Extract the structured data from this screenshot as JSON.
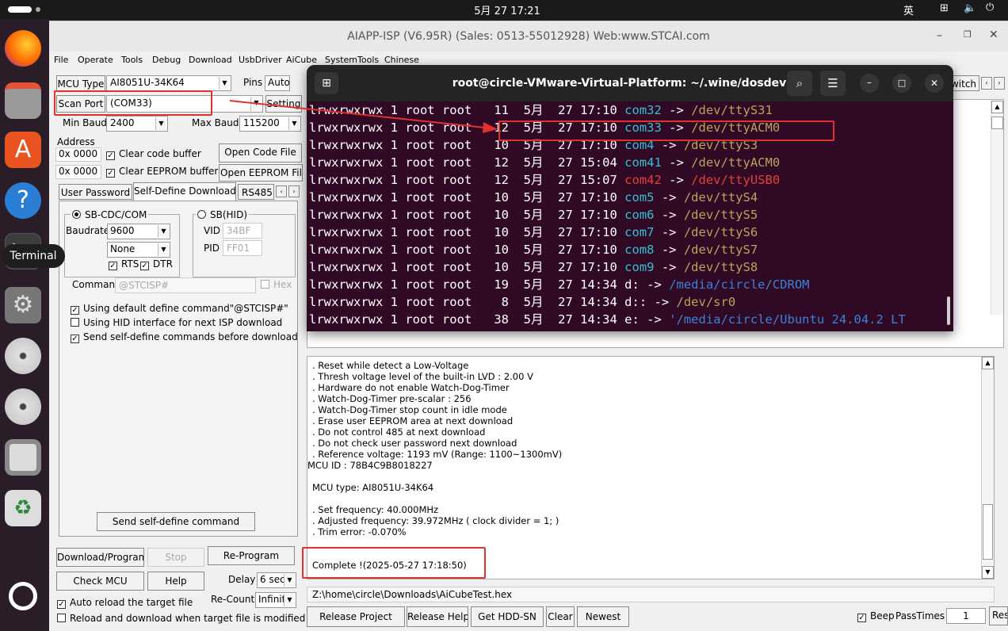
{
  "system": {
    "clock": "5月 27  17:21",
    "ime": "英"
  },
  "dock": {
    "tooltip": "Terminal"
  },
  "window": {
    "title": "AIAPP-ISP (V6.95R) (Sales: 0513-55012928) Web:www.STCAI.com"
  },
  "menu": [
    "File",
    "Operate",
    "Tools",
    "Debug",
    "Download",
    "UsbDriver",
    "AiCube",
    "SystemTools",
    "Chinese"
  ],
  "left": {
    "mcu_type_label": "MCU Type",
    "mcu_type": "AI8051U-34K64",
    "pins_label": "Pins",
    "pins": "Auto",
    "scan_port": "Scan Port",
    "port": "(COM33)",
    "setting": "Setting",
    "min_baud_label": "Min Baud",
    "min_baud": "2400",
    "max_baud_label": "Max Baud",
    "max_baud": "115200",
    "address_label": "Address",
    "addr1": "0x 0000",
    "addr2": "0x 0000",
    "clear_code": "Clear code buffer",
    "clear_eeprom": "Clear EEPROM buffer",
    "open_code": "Open Code File",
    "open_eeprom": "Open EEPROM File",
    "tabs": [
      "User Password",
      "Self-Define Download",
      "RS485"
    ],
    "sb_cdc": "SB-CDC/COM",
    "sb_hid": "SB(HID)",
    "baudrate_label": "Baudrate",
    "baudrate": "9600",
    "parity": "None",
    "vid_label": "VID",
    "vid": "34BF",
    "pid_label": "PID",
    "pid": "FF01",
    "rts": "RTS",
    "dtr": "DTR",
    "command_label": "Command",
    "command": "@STCISP#",
    "hex": "Hex",
    "opt1": "Using default define command\"@STCISP#\"",
    "opt2": "Using HID interface for next ISP download",
    "opt3": "Send self-define commands before download",
    "send_cmd": "Send self-define command",
    "download": "Download/Program",
    "stop": "Stop",
    "reprogram": "Re-Program",
    "check_mcu": "Check MCU",
    "help": "Help",
    "delay_label": "Delay",
    "delay": "6 sec",
    "recount_label": "Re-Count",
    "recount": "Infinite",
    "auto_reload": "Auto reload the target file",
    "reload_modified": "Reload and download when target file is modified"
  },
  "right": {
    "switch": "witch"
  },
  "log": {
    "lines": [
      ". Reset while detect a Low-Voltage",
      ". Thresh voltage level of the built-in LVD : 2.00 V",
      ". Hardware do not enable Watch-Dog-Timer",
      ". Watch-Dog-Timer pre-scalar : 256",
      ". Watch-Dog-Timer stop count in idle mode",
      ". Erase user EEPROM area at next download",
      ". Do not control 485 at next download",
      ". Do not check user password next download",
      ". Reference voltage: 1193 mV (Range: 1100~1300mV)",
      "MCU ID : 78B4C9B8018227",
      "",
      "MCU type: AI8051U-34K64",
      "",
      ". Set frequency: 40.000MHz",
      ". Adjusted frequency: 39.972MHz ( clock divider = 1; )",
      ". Trim error: -0.070%",
      "",
      "",
      "Complete !(2025-05-27 17:18:50)"
    ]
  },
  "bottom": {
    "path": "Z:\\home\\circle\\Downloads\\AiCubeTest.hex",
    "release_project": "Release Project",
    "release_help": "Release Help",
    "hdd": "Get HDD-SN",
    "clear": "Clear",
    "newest": "Newest",
    "beep": "Beep",
    "pass_times_label": "PassTimes",
    "pass_times": "1",
    "reset": "Reset"
  },
  "terminal": {
    "title": "root@circle-VMware-Virtual-Platform: ~/.wine/dosdevices",
    "rows": [
      {
        "perm": "lrwxrwxrwx 1 root root",
        "size": "11",
        "date": "5月  27 17:10",
        "name": "com32",
        "target": "/dev/ttyS31",
        "ncolor": "#34c0d4",
        "tcolor": "#b5a55c"
      },
      {
        "perm": "lrwxrwxrwx 1 root root",
        "size": "12",
        "date": "5月  27 17:10",
        "name": "com33",
        "target": "/dev/ttyACM0",
        "ncolor": "#34c0d4",
        "tcolor": "#b5a55c"
      },
      {
        "perm": "lrwxrwxrwx 1 root root",
        "size": "10",
        "date": "5月  27 17:10",
        "name": "com4",
        "target": "/dev/ttyS3",
        "ncolor": "#34c0d4",
        "tcolor": "#b5a55c"
      },
      {
        "perm": "lrwxrwxrwx 1 root root",
        "size": "12",
        "date": "5月  27 15:04",
        "name": "com41",
        "target": "/dev/ttyACM0",
        "ncolor": "#34c0d4",
        "tcolor": "#b5a55c"
      },
      {
        "perm": "lrwxrwxrwx 1 root root",
        "size": "12",
        "date": "5月  27 15:07",
        "name": "com42",
        "target": "/dev/ttyUSB0",
        "ncolor": "#e2403a",
        "tcolor": "#e2403a"
      },
      {
        "perm": "lrwxrwxrwx 1 root root",
        "size": "10",
        "date": "5月  27 17:10",
        "name": "com5",
        "target": "/dev/ttyS4",
        "ncolor": "#34c0d4",
        "tcolor": "#b5a55c"
      },
      {
        "perm": "lrwxrwxrwx 1 root root",
        "size": "10",
        "date": "5月  27 17:10",
        "name": "com6",
        "target": "/dev/ttyS5",
        "ncolor": "#34c0d4",
        "tcolor": "#b5a55c"
      },
      {
        "perm": "lrwxrwxrwx 1 root root",
        "size": "10",
        "date": "5月  27 17:10",
        "name": "com7",
        "target": "/dev/ttyS6",
        "ncolor": "#34c0d4",
        "tcolor": "#b5a55c"
      },
      {
        "perm": "lrwxrwxrwx 1 root root",
        "size": "10",
        "date": "5月  27 17:10",
        "name": "com8",
        "target": "/dev/ttyS7",
        "ncolor": "#34c0d4",
        "tcolor": "#b5a55c"
      },
      {
        "perm": "lrwxrwxrwx 1 root root",
        "size": "10",
        "date": "5月  27 17:10",
        "name": "com9",
        "target": "/dev/ttyS8",
        "ncolor": "#34c0d4",
        "tcolor": "#b5a55c"
      },
      {
        "perm": "lrwxrwxrwx 1 root root",
        "size": "19",
        "date": "5月  27 14:34",
        "name": "d:",
        "target": "/media/circle/CDROM",
        "ncolor": "#ffffff",
        "tcolor": "#3b82d6"
      },
      {
        "perm": "lrwxrwxrwx 1 root root",
        "size": "8",
        "date": "5月  27 14:34",
        "name": "d::",
        "target": "/dev/sr0",
        "ncolor": "#ffffff",
        "tcolor": "#b5a55c"
      },
      {
        "perm": "lrwxrwxrwx 1 root root",
        "size": "38",
        "date": "5月  27 14:34",
        "name": "e:",
        "target": "'/media/circle/Ubuntu 24.04.2 LT",
        "ncolor": "#ffffff",
        "tcolor": "#3b82d6"
      }
    ]
  }
}
